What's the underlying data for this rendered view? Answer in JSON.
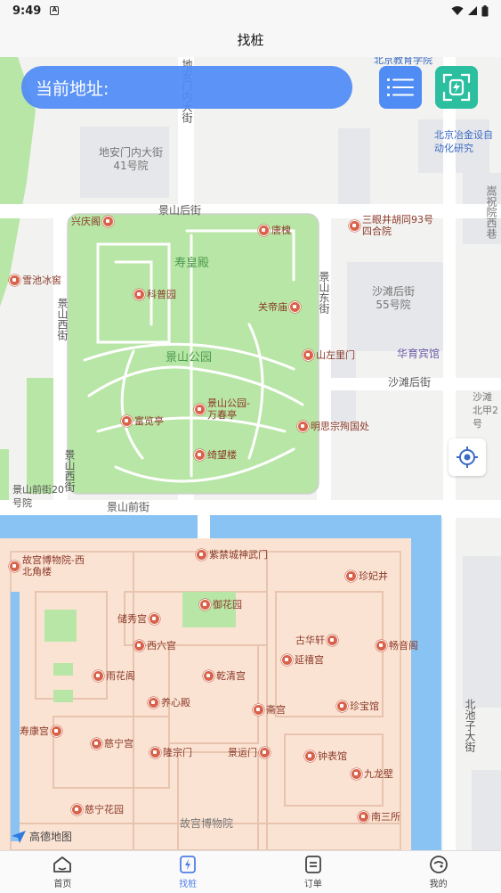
{
  "status_bar": {
    "time": "9:49",
    "notification_icon": "A"
  },
  "header": {
    "title": "找桩"
  },
  "address": {
    "label": "当前地址:"
  },
  "map": {
    "roads": {
      "dianmen_inner": "地安门内大街",
      "jingshan_hou": "景山后街",
      "jingshan_qian": "景山前街",
      "jingshan_xi": "景山西街",
      "jingshan_dong": "景山东街",
      "shatan_hou": "沙滩后街",
      "beichizi": "北池子大街",
      "songzhuyuan_xi": "嵩祝院西巷",
      "shatan_north": "沙滩北甲2号"
    },
    "labels": {
      "dianmen_41": "地安门内大街41号院",
      "shatan_55": "沙滩后街55号院",
      "jingshan_qian_20": "景山前街20号院",
      "shouhuang": "寿皇殿",
      "jingshan_park": "景山公园",
      "palace_museum_area": "故宫博物院",
      "huayu": "华育宾馆",
      "metallurgy": "北京冶金设自动化研究",
      "edu_college": "北京教育学院",
      "amap": "高德地图"
    },
    "pois": [
      "兴庆阁",
      "唐槐",
      "雪池冰窖",
      "科普园",
      "关帝庙",
      "山左里门",
      "景山公园-万春亭",
      "富览亭",
      "明思宗殉国处",
      "绮望楼",
      "三眼井胡同93号四合院",
      "故宫博物院-西北角楼",
      "紫禁城神武门",
      "珍妃井",
      "御花园",
      "储秀宫",
      "西六宫",
      "古华轩",
      "畅音阁",
      "延禧宫",
      "雨花阁",
      "乾清宫",
      "养心殿",
      "斋宫",
      "珍宝馆",
      "寿康宫",
      "慈宁宫",
      "隆宗门",
      "景运门",
      "钟表馆",
      "九龙壁",
      "慈宁花园",
      "南三所"
    ]
  },
  "nav": {
    "items": [
      {
        "label": "首页",
        "icon": "home-icon"
      },
      {
        "label": "找桩",
        "icon": "find-pile-icon"
      },
      {
        "label": "订单",
        "icon": "order-icon"
      },
      {
        "label": "我的",
        "icon": "profile-icon"
      }
    ]
  },
  "colors": {
    "accent": "#4f8cf4",
    "scan": "#2bbfa0",
    "park": "#b8e6a6",
    "palace": "#fbe3d3",
    "water": "#88c3f4",
    "poi": "#d8624a"
  }
}
